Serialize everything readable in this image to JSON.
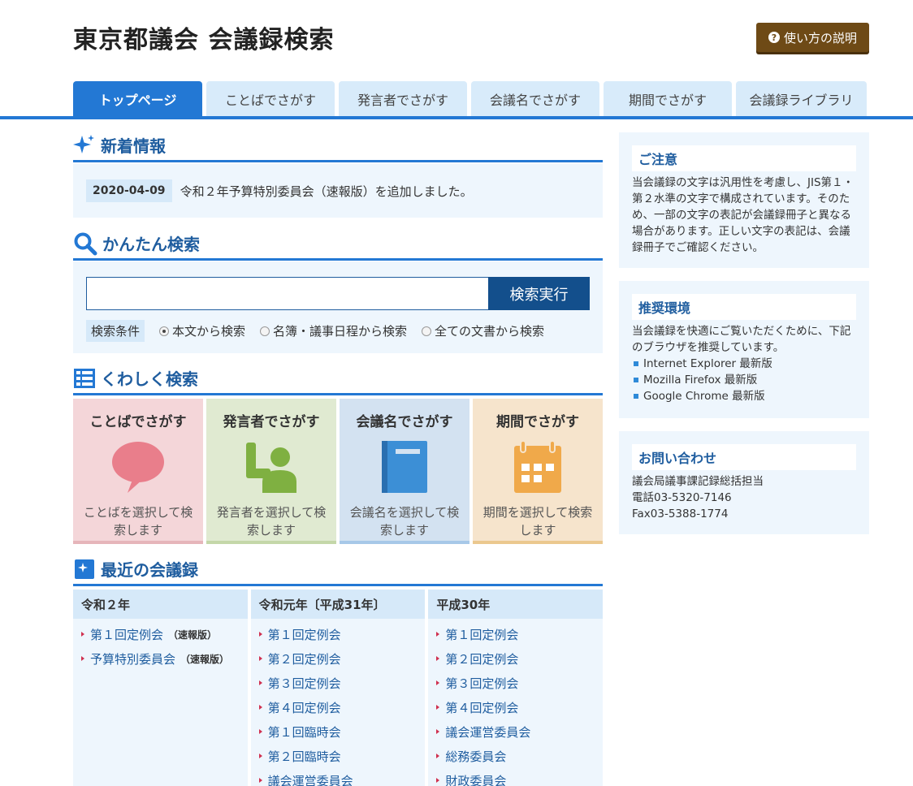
{
  "header": {
    "title": "東京都議会 会議録検索",
    "help_label": "使い方の説明"
  },
  "nav": {
    "tabs": [
      {
        "label": "トップページ"
      },
      {
        "label": "ことばでさがす"
      },
      {
        "label": "発言者でさがす"
      },
      {
        "label": "会議名でさがす"
      },
      {
        "label": "期間でさがす"
      },
      {
        "label": "会議録ライブラリ"
      }
    ]
  },
  "news": {
    "heading": "新着情報",
    "date": "2020-04-09",
    "text": "令和２年予算特別委員会（速報版）を追加しました。"
  },
  "search": {
    "heading": "かんたん検索",
    "value": "",
    "submit_label": "検索実行",
    "condition_label": "検索条件",
    "options": [
      {
        "label": "本文から検索",
        "checked": true
      },
      {
        "label": "名簿・議事日程から検索",
        "checked": false
      },
      {
        "label": "全ての文書から検索",
        "checked": false
      }
    ]
  },
  "detail": {
    "heading": "くわしく検索",
    "cards": [
      {
        "title": "ことばでさがす",
        "desc": "ことばを選択して検索します",
        "icon": "speech-bubble-icon",
        "color": "#e97e8b"
      },
      {
        "title": "発言者でさがす",
        "desc": "発言者を選択して検索します",
        "icon": "speaker-icon",
        "color": "#7fb041"
      },
      {
        "title": "会議名でさがす",
        "desc": "会議名を選択して検索します",
        "icon": "notebook-icon",
        "color": "#3c8fd6"
      },
      {
        "title": "期間でさがす",
        "desc": "期間を選択して検索します",
        "icon": "calendar-icon",
        "color": "#f0a94a"
      }
    ]
  },
  "recent": {
    "heading": "最近の会議録",
    "columns": [
      {
        "year": "令和２年",
        "items": [
          {
            "label": "第１回定例会",
            "tag": "（速報版）"
          },
          {
            "label": "予算特別委員会",
            "tag": "（速報版）"
          }
        ]
      },
      {
        "year": "令和元年〔平成31年〕",
        "items": [
          {
            "label": "第１回定例会"
          },
          {
            "label": "第２回定例会"
          },
          {
            "label": "第３回定例会"
          },
          {
            "label": "第４回定例会"
          },
          {
            "label": "第１回臨時会"
          },
          {
            "label": "第２回臨時会"
          },
          {
            "label": "議会運営委員会"
          }
        ]
      },
      {
        "year": "平成30年",
        "items": [
          {
            "label": "第１回定例会"
          },
          {
            "label": "第２回定例会"
          },
          {
            "label": "第３回定例会"
          },
          {
            "label": "第４回定例会"
          },
          {
            "label": "議会運営委員会"
          },
          {
            "label": "総務委員会"
          },
          {
            "label": "財政委員会"
          }
        ]
      }
    ]
  },
  "sidebar": {
    "notice": {
      "title": "ご注意",
      "text": "当会議録の文字は汎用性を考慮し、JIS第１・第２水準の文字で構成されています。そのため、一部の文字の表記が会議録冊子と異なる場合があります。正しい文字の表記は、会議録冊子でご確認ください。"
    },
    "env": {
      "title": "推奨環境",
      "text": "当会議録を快適にご覧いただくために、下記のブラウザを推奨しています。",
      "browsers": [
        "Internet Explorer 最新版",
        "Mozilla Firefox 最新版",
        "Google Chrome 最新版"
      ]
    },
    "contact": {
      "title": "お問い合わせ",
      "lines": [
        "議会局議事課記録総括担当",
        "電話03-5320-7146",
        "Fax03-5388-1774"
      ]
    }
  }
}
